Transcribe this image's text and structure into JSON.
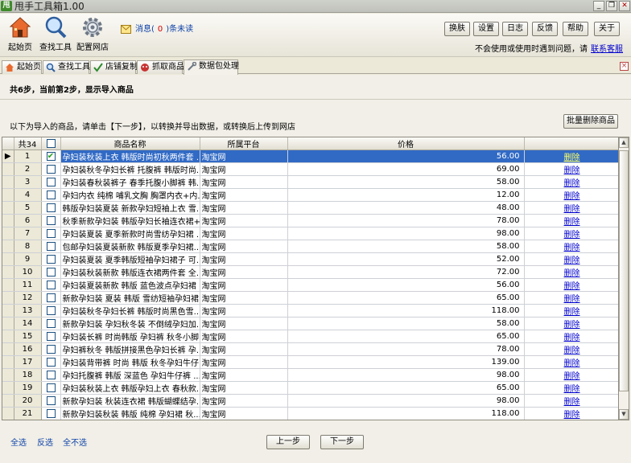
{
  "window": {
    "logo_text": "甩",
    "title": "甩手工具箱1.00",
    "controls": [
      "_",
      "❐",
      "✕"
    ]
  },
  "toolbar": {
    "home_label": "起始页",
    "find_tool_label": "查找工具",
    "config_shop_label": "配置网店",
    "message_prefix": "消息(",
    "message_count": "0",
    "message_suffix": ")条未读",
    "buttons": [
      "换肤",
      "设置",
      "日志",
      "反馈",
      "帮助",
      "关于"
    ],
    "help_text": "不会使用或使用时遇到问题，请",
    "help_link": "联系客服"
  },
  "tabs": [
    {
      "label": "起始页",
      "icon": "home-icon"
    },
    {
      "label": "查找工具",
      "icon": "search-icon"
    },
    {
      "label": "店铺复制",
      "icon": "check-icon"
    },
    {
      "label": "抓取商品",
      "icon": "grab-icon"
    },
    {
      "label": "数据包处理",
      "icon": "tools-icon",
      "active": true
    }
  ],
  "main": {
    "step_title": "共6步，当前第2步，显示导入商品",
    "instruction": "以下为导入的商品，请单击【下一步】，以转换并导出数据，或转换后上传到网店",
    "batch_delete": "批量删除商品"
  },
  "grid": {
    "total_label": "共34",
    "headers": {
      "name": "商品名称",
      "platform": "所属平台",
      "price": "价格",
      "action": ""
    },
    "rows": [
      {
        "no": "1",
        "checked": true,
        "name": "孕妇装秋装上衣 韩版时尚初秋两件套 ...",
        "platform": "淘宝网",
        "price": "56.00",
        "action": "删除"
      },
      {
        "no": "2",
        "checked": false,
        "name": "孕妇装秋冬孕妇长裤 托腹裤 韩版时尚...",
        "platform": "淘宝网",
        "price": "69.00",
        "action": "删除"
      },
      {
        "no": "3",
        "checked": false,
        "name": "孕妇装春秋装裤子 春季托腹小脚裤 韩...",
        "platform": "淘宝网",
        "price": "58.00",
        "action": "删除"
      },
      {
        "no": "4",
        "checked": false,
        "name": "孕妇内衣 纯棉 哺乳文胸 胸罩内衣+内...",
        "platform": "淘宝网",
        "price": "12.00",
        "action": "删除"
      },
      {
        "no": "5",
        "checked": false,
        "name": "韩版孕妇装夏装 新款孕妇短袖上衣 雪...",
        "platform": "淘宝网",
        "price": "48.00",
        "action": "删除"
      },
      {
        "no": "6",
        "checked": false,
        "name": "秋季新款孕妇装 韩版孕妇长袖连衣裙+...",
        "platform": "淘宝网",
        "price": "78.00",
        "action": "删除"
      },
      {
        "no": "7",
        "checked": false,
        "name": "孕妇装夏装 夏季新款时尚雪纺孕妇裙 ...",
        "platform": "淘宝网",
        "price": "98.00",
        "action": "删除"
      },
      {
        "no": "8",
        "checked": false,
        "name": "包邮孕妇装夏装新款 韩版夏季孕妇裙...",
        "platform": "淘宝网",
        "price": "58.00",
        "action": "删除"
      },
      {
        "no": "9",
        "checked": false,
        "name": "孕妇装夏装 夏季韩版短袖孕妇裙子 可...",
        "platform": "淘宝网",
        "price": "52.00",
        "action": "删除"
      },
      {
        "no": "10",
        "checked": false,
        "name": "孕妇装秋装新款 韩版连衣裙两件套 全...",
        "platform": "淘宝网",
        "price": "72.00",
        "action": "删除"
      },
      {
        "no": "11",
        "checked": false,
        "name": "孕妇装夏装新款 韩版 蓝色波点孕妇裙 ...",
        "platform": "淘宝网",
        "price": "56.00",
        "action": "删除"
      },
      {
        "no": "12",
        "checked": false,
        "name": "新款孕妇装 夏装 韩版 雪纺短袖孕妇裙...",
        "platform": "淘宝网",
        "price": "65.00",
        "action": "删除"
      },
      {
        "no": "13",
        "checked": false,
        "name": "孕妇装秋冬孕妇长裤 韩版时尚黑色雪...",
        "platform": "淘宝网",
        "price": "118.00",
        "action": "删除"
      },
      {
        "no": "14",
        "checked": false,
        "name": "新款孕妇装 孕妇秋冬装 不倒绒孕妇加...",
        "platform": "淘宝网",
        "price": "58.00",
        "action": "删除"
      },
      {
        "no": "15",
        "checked": false,
        "name": "孕妇装长裤 时尚韩版 孕妇裤 秋冬小脚...",
        "platform": "淘宝网",
        "price": "65.00",
        "action": "删除"
      },
      {
        "no": "16",
        "checked": false,
        "name": "孕妇裤秋冬 韩版拼接黑色孕妇长裤 孕...",
        "platform": "淘宝网",
        "price": "78.00",
        "action": "删除"
      },
      {
        "no": "17",
        "checked": false,
        "name": "孕妇装背带裤 时尚 韩版 秋冬孕妇牛仔...",
        "platform": "淘宝网",
        "price": "139.00",
        "action": "删除"
      },
      {
        "no": "18",
        "checked": false,
        "name": "孕妇托腹裤 韩版 深蓝色 孕妇牛仔裤 ...",
        "platform": "淘宝网",
        "price": "98.00",
        "action": "删除"
      },
      {
        "no": "19",
        "checked": false,
        "name": "孕妇装秋装上衣 韩版孕妇上衣 春秋款...",
        "platform": "淘宝网",
        "price": "65.00",
        "action": "删除"
      },
      {
        "no": "20",
        "checked": false,
        "name": "新款孕妇装 秋装连衣裙 韩版蝴蝶结孕...",
        "platform": "淘宝网",
        "price": "98.00",
        "action": "删除"
      },
      {
        "no": "21",
        "checked": false,
        "name": "新款孕妇装秋装 韩版 纯棉 孕妇裙 秋...",
        "platform": "淘宝网",
        "price": "118.00",
        "action": "删除"
      },
      {
        "no": "22",
        "checked": false,
        "name": "孕妇装秋装时尚上衣 大码 孕妇卫衣 秋...",
        "platform": "淘宝网",
        "price": "88.00",
        "action": "删除"
      },
      {
        "no": "23",
        "checked": false,
        "name": "孕妇裙 孕妇装 秋装 长袖 连衣裙 时尚...",
        "platform": "淘宝网",
        "price": "99.00",
        "action": "删除"
      }
    ]
  },
  "footer": {
    "select_all": "全选",
    "invert": "反选",
    "select_none": "全不选",
    "prev": "上一步",
    "next": "下一步"
  },
  "colors": {
    "selection": "#316AC5",
    "link": "#0A3FA8",
    "window_bg": "#ECE9D8"
  }
}
